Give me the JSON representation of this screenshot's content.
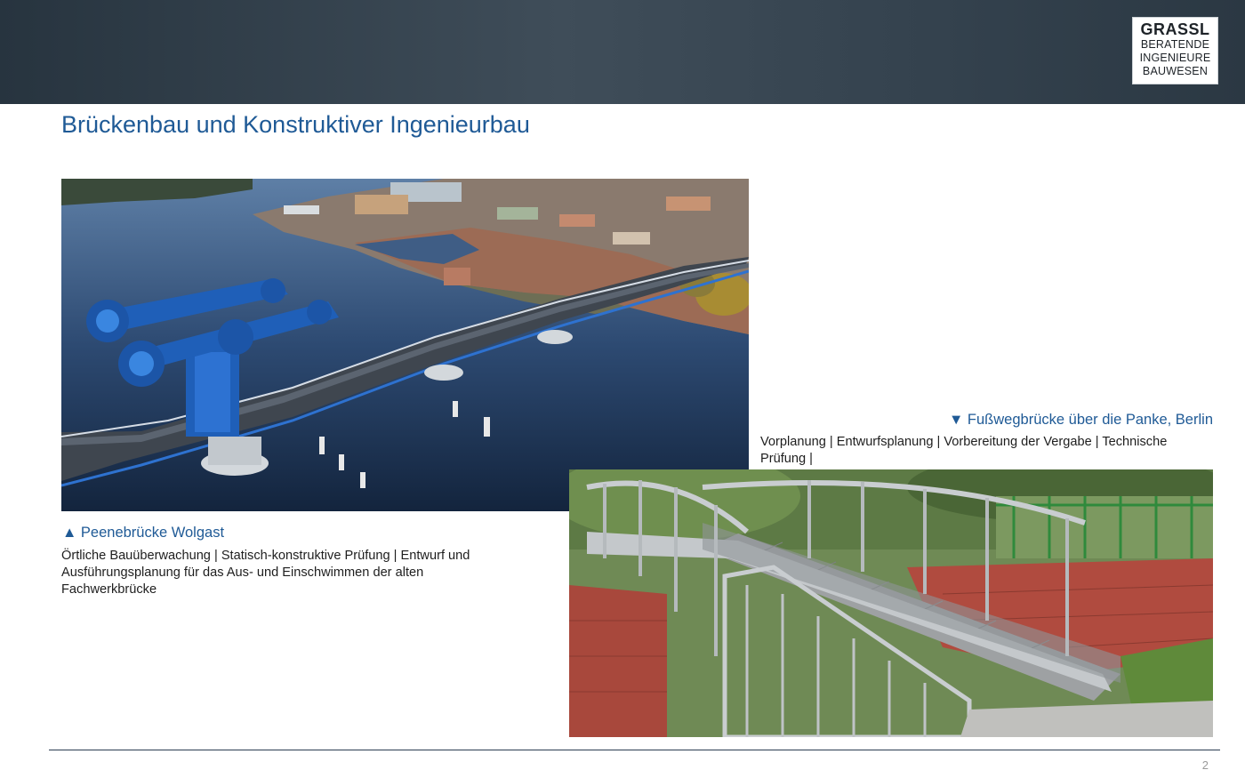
{
  "header": {
    "logo": {
      "line1": "GRASSL",
      "line2": "BERATENDE",
      "line3": "INGENIEURE",
      "line4": "BAUWESEN"
    }
  },
  "slide": {
    "title": "Brückenbau und Konstruktiver Ingenieurbau",
    "page_number": "2"
  },
  "projects": [
    {
      "title": "▲ Peenebrücke Wolgast",
      "description": "Örtliche Bauüberwachung | Statisch-konstruktive Prüfung | Entwurf und Ausführungsplanung für das Aus- und Einschwimmen der alten Fachwerkbrücke"
    },
    {
      "title": "▼ Fußwegbrücke über die Panke, Berlin",
      "description": "Vorplanung | Entwurfsplanung | Vorbereitung der Vergabe | Technische Prüfung |"
    }
  ],
  "colors": {
    "header_dark": "#2b3843",
    "title_blue": "#1f5a96",
    "bridge_blue": "#1f5fb8",
    "footer_line": "#2a3d52"
  }
}
